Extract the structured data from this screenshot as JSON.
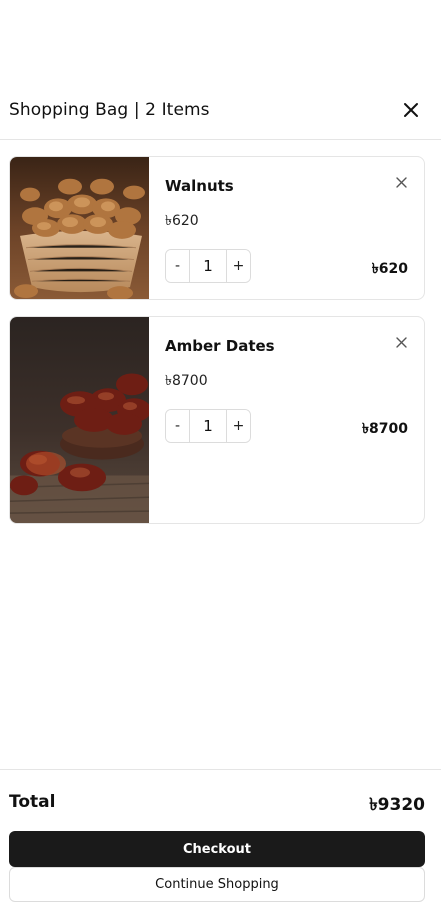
{
  "header": {
    "title": "Shopping Bag | 2 Items"
  },
  "items": [
    {
      "name": "Walnuts",
      "price": "৳620",
      "quantity": "1",
      "line_total": "৳620",
      "image": "walnuts-photo"
    },
    {
      "name": "Amber Dates",
      "price": "৳8700",
      "quantity": "1",
      "line_total": "৳8700",
      "image": "dates-photo"
    }
  ],
  "stepper": {
    "decrement": "-",
    "increment": "+"
  },
  "summary": {
    "total_label": "Total",
    "total_value": "৳9320"
  },
  "actions": {
    "checkout": "Checkout",
    "continue": "Continue Shopping"
  },
  "colors": {
    "primary_button": "#1a1a1a",
    "border": "#e5e5e5"
  }
}
